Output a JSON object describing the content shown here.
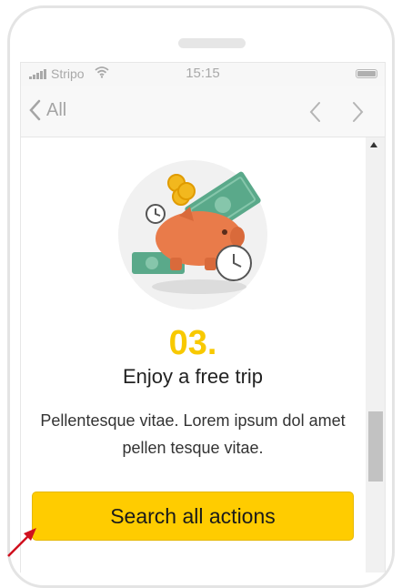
{
  "status_bar": {
    "carrier": "Stripo",
    "time": "15:15"
  },
  "nav": {
    "back_label": "All"
  },
  "content": {
    "step_number": "03.",
    "title": "Enjoy a free trip",
    "description": "Pellentesque vitae. Lorem ipsum dol amet pellen tesque vitae.",
    "button_label": "Search all actions"
  },
  "colors": {
    "accent": "#ffcc00",
    "step_number": "#f8c900"
  },
  "icons": [
    "signal-icon",
    "wifi-icon",
    "battery-icon",
    "chevron-left-icon",
    "chevron-right-icon",
    "piggy-bank-illustration",
    "cursor-arrow-icon"
  ]
}
